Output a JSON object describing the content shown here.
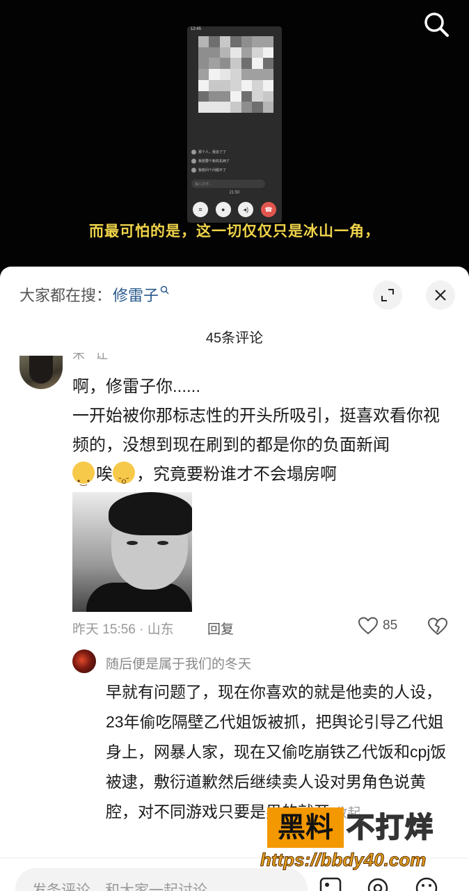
{
  "video": {
    "subtitle": "而最可怕的是，这一切仅仅只是冰山一角，",
    "phone_status": "12:45",
    "chat": [
      "那个人，我去了了",
      "我想要个新的东西了",
      "我想问个问题不了"
    ],
    "input_placeholder": "输入文字...",
    "call_time": "21:50"
  },
  "panel": {
    "hot_search_prefix": "大家都在搜：",
    "hot_search_term": "修雷子",
    "comment_count": "45条评论"
  },
  "comment1": {
    "text_line1": "啊，修雷子你......",
    "text_line2": "一开始被你那标志性的开头所吸引，挺喜欢看你视频的，没想到现在刷到的都是你的负面新闻",
    "text_line3": "唉",
    "text_line4": "，究竟要粉谁才不会塌房啊",
    "meta": "昨天 15:56 · 山东",
    "reply_label": "回复",
    "likes": "85"
  },
  "comment2": {
    "author": "随后便是属于我们的冬天",
    "text": "早就有问题了，现在你喜欢的就是他卖的人设，23年偷吃隔壁乙代姐饭被抓，把舆论引导乙代姐身上，网暴人家，现在又偷吃崩铁乙代饭和cpj饭被逮，敷衍道歉然后继续卖人设对男角色说黄腔，对不同游戏只要是男的就开",
    "collapse_label": "收起"
  },
  "watermark": {
    "box_text": "黑料",
    "right_text": "不打烊",
    "url": "https://bbdy40.com"
  },
  "bottom_bar": {
    "placeholder": "发条评论，和大家一起讨论"
  },
  "colors": {
    "subtitle": "#f0d44a",
    "link": "#2a5a8c",
    "end_call": "#e2554f",
    "watermark_orange": "#f39800"
  }
}
